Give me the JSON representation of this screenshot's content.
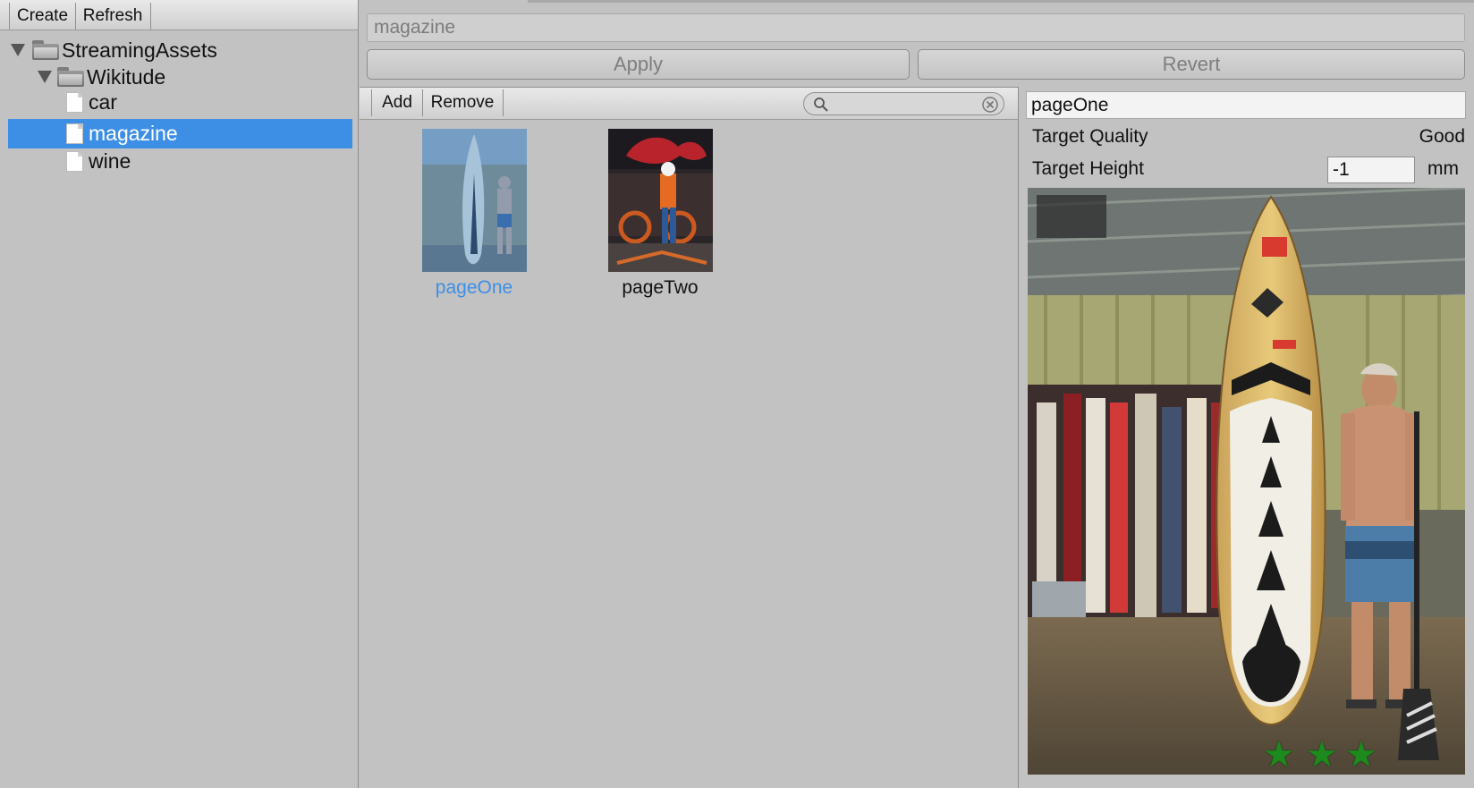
{
  "left_panel": {
    "toolbar": {
      "create_label": "Create",
      "refresh_label": "Refresh"
    },
    "tree": {
      "root": "StreamingAssets",
      "folder": "Wikitude",
      "files": [
        "car",
        "magazine",
        "wine"
      ],
      "selected": "magazine"
    }
  },
  "editor": {
    "name_value": "magazine",
    "apply_label": "Apply",
    "revert_label": "Revert"
  },
  "targets_panel": {
    "toolbar": {
      "add_label": "Add",
      "remove_label": "Remove",
      "search_value": ""
    },
    "items": [
      {
        "name": "pageOne",
        "selected": true
      },
      {
        "name": "pageTwo",
        "selected": false
      }
    ]
  },
  "inspector": {
    "target_name": "pageOne",
    "quality_label": "Target Quality",
    "quality_value": "Good",
    "height_label": "Target Height",
    "height_value": "-1",
    "height_unit": "mm",
    "rating_stars": 3
  },
  "colors": {
    "selection": "#3d8fe6",
    "selected_text": "#3d8fe6",
    "star": "#1d8a1d"
  }
}
